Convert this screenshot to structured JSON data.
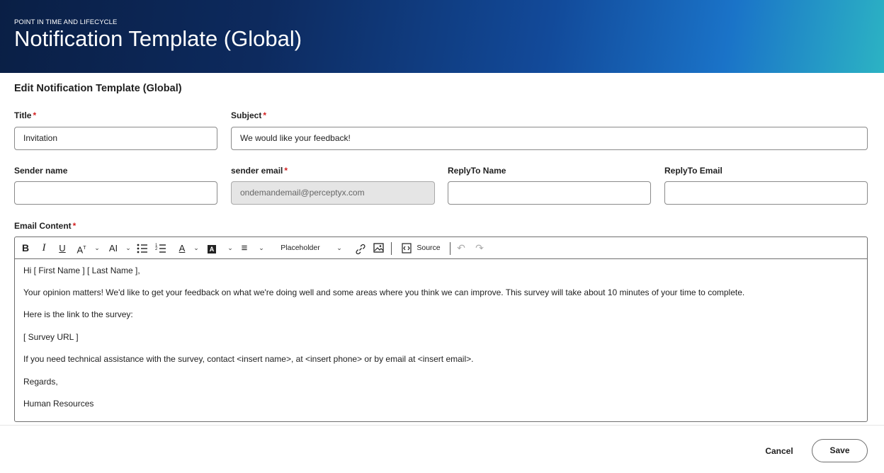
{
  "header": {
    "eyebrow": "POINT IN TIME AND LIFECYCLE",
    "title": "Notification Template (Global)"
  },
  "form": {
    "section_title": "Edit Notification Template (Global)",
    "required_mark": "*",
    "title_label": "Title",
    "title_value": "Invitation",
    "subject_label": "Subject",
    "subject_value": "We would like your feedback!",
    "sender_name_label": "Sender name",
    "sender_name_value": "",
    "sender_email_label": "sender email",
    "sender_email_value": "ondemandemail@perceptyx.com",
    "replyto_name_label": "ReplyTo Name",
    "replyto_name_value": "",
    "replyto_email_label": "ReplyTo Email",
    "replyto_email_value": "",
    "email_content_label": "Email Content"
  },
  "toolbar": {
    "bold": "B",
    "italic": "I",
    "underline": "U",
    "font_size_glyph": "A",
    "font_family_glyph": "AI",
    "font_color_glyph": "A",
    "font_background_glyph": "A",
    "align_glyph": "≡",
    "placeholder_label": "Placeholder",
    "source_label": "Source"
  },
  "email_body": [
    "Hi [ First Name ] [ Last Name ],",
    "Your opinion matters! We'd like to get your feedback on what we're doing well and some areas where you think we can improve. This survey will take about 10 minutes of your time to complete.",
    "Here is the link to the survey:",
    "[ Survey URL ]",
    "If you need technical assistance with the survey, contact <insert name>, at <insert phone> or by email at <insert email>.",
    "Regards,",
    "Human Resources"
  ],
  "footer": {
    "cancel_label": "Cancel",
    "save_label": "Save"
  },
  "colors": {
    "required": "#d21f1f",
    "banner_start": "#0a1f45",
    "banner_end": "#2cb3c4"
  }
}
